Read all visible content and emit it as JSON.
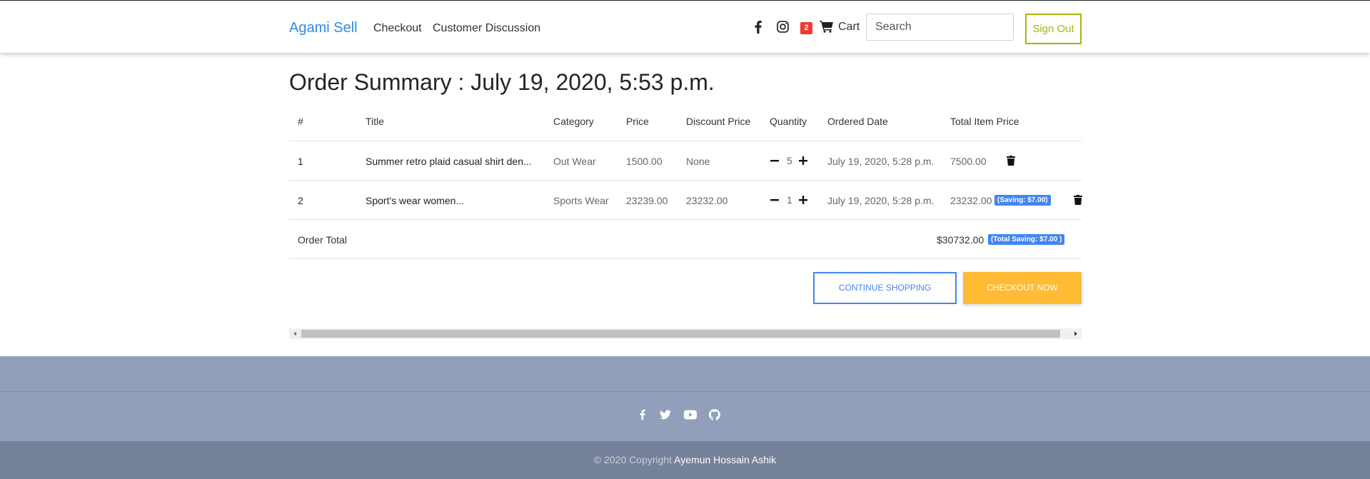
{
  "navbar": {
    "brand": "Agami Sell",
    "links": [
      "Checkout",
      "Customer Discussion"
    ],
    "cart_count": "2",
    "cart_label": "Cart",
    "search_placeholder": "Search",
    "sign_out": "Sign Out",
    "icons": [
      "facebook-icon",
      "instagram-icon",
      "cart-icon"
    ]
  },
  "order": {
    "title": "Order Summary : July 19, 2020, 5:53 p.m.",
    "columns": [
      "#",
      "Title",
      "Category",
      "Price",
      "Discount Price",
      "Quantity",
      "Ordered Date",
      "Total Item Price"
    ],
    "rows": [
      {
        "num": "1",
        "title": "Summer retro plaid casual shirt den...",
        "category": "Out Wear",
        "price": "1500.00",
        "discount": "None",
        "quantity": "5",
        "date": "July 19, 2020, 5:28 p.m.",
        "total": "7500.00",
        "saving": ""
      },
      {
        "num": "2",
        "title": "Sport's wear women...",
        "category": "Sports Wear",
        "price": "23239.00",
        "discount": "23232.00",
        "quantity": "1",
        "date": "July 19, 2020, 5:28 p.m.",
        "total": "23232.00",
        "saving": "(Saving: $7.00)"
      }
    ],
    "total_label": "Order Total",
    "total_value": "$30732.00",
    "total_saving": "(Total Saving: $7.00 )"
  },
  "actions": {
    "continue": "CONTINUE SHOPPING",
    "checkout": "CHECKOUT NOW"
  },
  "footer": {
    "icons": [
      "facebook-icon",
      "twitter-icon",
      "youtube-icon",
      "github-icon"
    ],
    "copyright_prefix": "© 2020 Copyright ",
    "author": "Ayemun Hossain Ashik"
  },
  "colors": {
    "brand": "#2f8be6",
    "badge": "#ef3a33",
    "sign_out": "#aab516",
    "primary": "#4285f4",
    "checkout": "#ffbb33",
    "footer": "#929fba",
    "copyright_bg": "#76819a"
  }
}
